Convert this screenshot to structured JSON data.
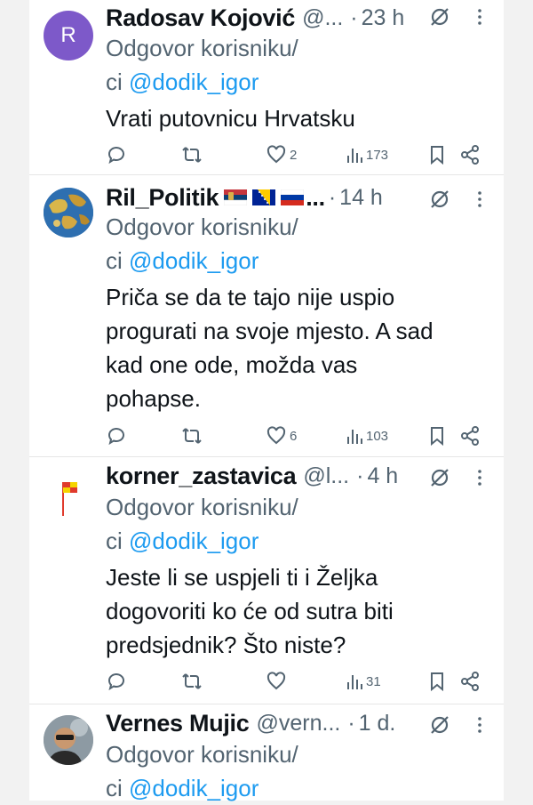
{
  "colors": {
    "text": "#0f1419",
    "secondary": "#536471",
    "link": "#1d9bf0",
    "avatar_purple": "#7d59c9"
  },
  "tweets": [
    {
      "avatar_letter": "R",
      "name": "Radosav Kojović",
      "handle": "@...",
      "time": "23 h",
      "reply_prefix": "Odgovor korisniku/",
      "reply_suffix": "ci",
      "mention": "@dodik_igor",
      "body": [
        "Vrati putovnicu Hrvatsku"
      ],
      "likes": "2",
      "views": "173"
    },
    {
      "name": "Ril_Politik",
      "name_suffix": "...",
      "flags": [
        "serbia-flag",
        "bosnia-flag",
        "russia-flag"
      ],
      "time": "14 h",
      "reply_prefix": "Odgovor korisniku/",
      "reply_suffix": "ci",
      "mention": "@dodik_igor",
      "body": [
        "Priča se da te tajo nije uspio",
        "progurati na svoje mjesto. A sad",
        "kad one ode, možda vas",
        "pohapse."
      ],
      "likes": "6",
      "views": "103"
    },
    {
      "name": "korner_zastavica",
      "handle": "@l...",
      "time": "4 h",
      "reply_prefix": "Odgovor korisniku/",
      "reply_suffix": "ci",
      "mention": "@dodik_igor",
      "body": [
        "Jeste li se uspjeli ti i Željka",
        "dogovoriti ko će od sutra biti",
        "predsjednik? Što niste?"
      ],
      "likes": "",
      "views": "31"
    },
    {
      "name": "Vernes Mujic",
      "handle": "@vern...",
      "time": "1 d.",
      "reply_prefix": "Odgovor korisniku/",
      "reply_suffix": "ci",
      "mention": "@dodik_igor"
    }
  ]
}
